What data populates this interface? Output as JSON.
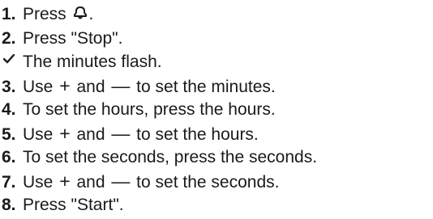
{
  "steps": [
    {
      "marker": "1.",
      "text_before": "Press ",
      "icon": "bell-icon",
      "text_after": "."
    },
    {
      "marker": "2.",
      "text": "Press \"Stop\"."
    },
    {
      "marker_icon": "checkmark-icon",
      "text": "The minutes flash."
    },
    {
      "marker": "3.",
      "text_before": "Use ",
      "plus": "+",
      "mid": " and ",
      "minus": "—",
      "text_after": " to set the minutes."
    },
    {
      "marker": "4.",
      "text": "To set the hours, press the hours."
    },
    {
      "marker": "5.",
      "text_before": "Use ",
      "plus": "+",
      "mid": " and ",
      "minus": "—",
      "text_after": " to set the hours."
    },
    {
      "marker": "6.",
      "text": "To set the seconds, press the seconds."
    },
    {
      "marker": "7.",
      "text_before": "Use ",
      "plus": "+",
      "mid": " and ",
      "minus": "—",
      "text_after": " to set the seconds."
    },
    {
      "marker": "8.",
      "text": "Press \"Start\"."
    }
  ]
}
